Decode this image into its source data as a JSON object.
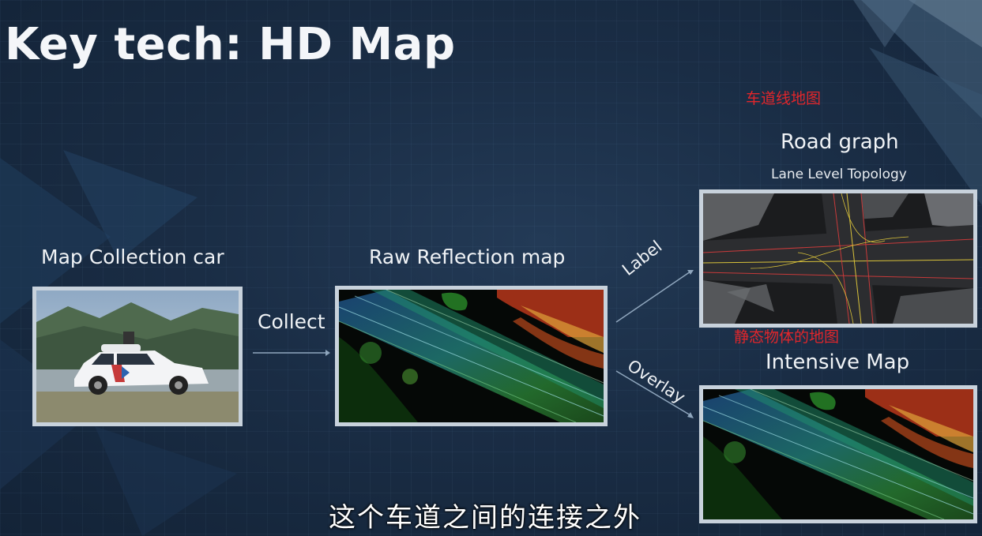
{
  "slide": {
    "title": "Key tech: HD Map",
    "notes": {
      "lane_map": "车道线地图",
      "static_map": "静态物体的地图"
    },
    "road_graph": {
      "heading": "Road graph",
      "subheading": "Lane Level Topology"
    },
    "collection_car": {
      "heading": "Map Collection car"
    },
    "raw_map": {
      "heading": "Raw Reflection map"
    },
    "intensive_map": {
      "heading": "Intensive Map"
    },
    "arrows": {
      "collect": "Collect",
      "label": "Label",
      "overlay": "Overlay"
    },
    "subtitle": "这个车道之间的连接之外"
  },
  "colors": {
    "background": "#1a2d45",
    "frame": "#c8d2dc",
    "note_red": "#e0262b"
  }
}
